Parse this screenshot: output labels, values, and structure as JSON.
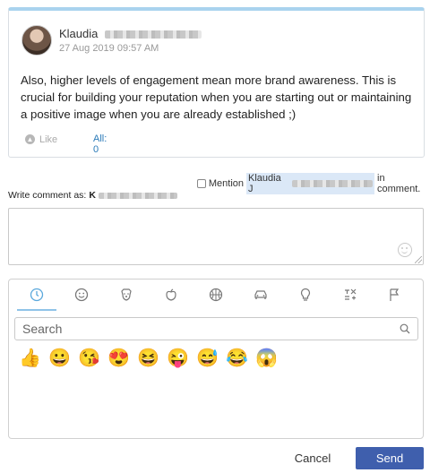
{
  "post": {
    "author_first": "Klaudia",
    "date": "27 Aug 2019 09:57 AM",
    "text": "Also, higher levels of engagement mean more brand awareness. This is crucial for building your reputation when you are starting out or maintaining a positive image when you are already established ;)",
    "like_label": "Like",
    "all_label": "All: 0"
  },
  "comment": {
    "mention_label": "Mention",
    "mention_name": "Klaudia J",
    "mention_suffix": "in comment.",
    "write_as_label": "Write comment as:",
    "write_as_name_start": "K",
    "textarea_value": "",
    "textarea_placeholder": ""
  },
  "emoji_picker": {
    "tabs": [
      "clock-icon",
      "smiley-icon",
      "dog-icon",
      "apple-icon",
      "basketball-icon",
      "car-icon",
      "lightbulb-icon",
      "symbols-icon",
      "flag-icon"
    ],
    "active_tab": 0,
    "search_placeholder": "Search",
    "recent": [
      "👍",
      "😀",
      "😘",
      "😍",
      "😆",
      "😜",
      "😅",
      "😂",
      "😱"
    ]
  },
  "buttons": {
    "cancel": "Cancel",
    "send": "Send"
  },
  "colors": {
    "accent_top": "#a9d3ee",
    "link": "#2a7ab8",
    "send_bg": "#3f5fad",
    "mention_highlight": "#dbe8f7"
  }
}
